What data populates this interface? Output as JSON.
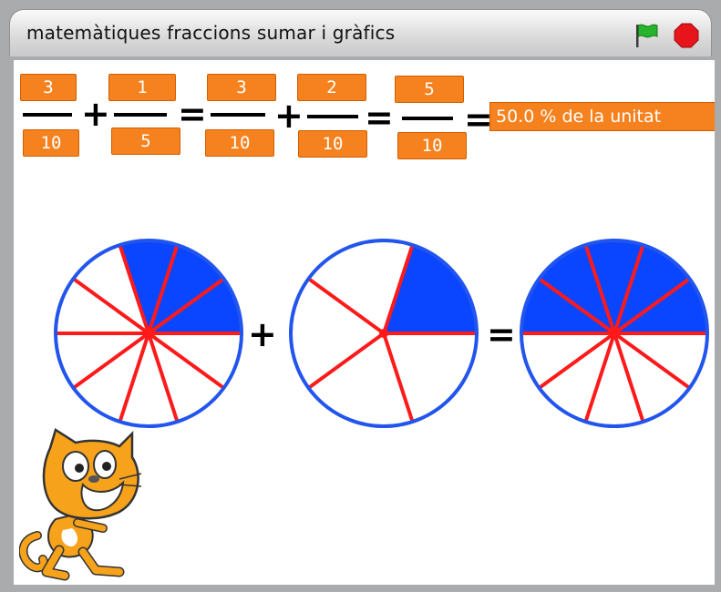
{
  "window": {
    "title": "matemàtiques fraccions sumar i gràfics",
    "flag_icon": "green-flag-icon",
    "stop_icon": "stop-sign-icon"
  },
  "colors": {
    "box_fill": "#f5821f",
    "pie_fill": "#0a46ff",
    "pie_outline": "#2255ee",
    "spokes": "#ff1a1a"
  },
  "equation": {
    "f1": {
      "num": "3",
      "den": "10"
    },
    "plus1": "+",
    "f2": {
      "num": "1",
      "den": "5"
    },
    "eq1": "=",
    "f3": {
      "num": "3",
      "den": "10"
    },
    "plus2": "+",
    "f4": {
      "num": "2",
      "den": "10"
    },
    "eq2": "=",
    "f5": {
      "num": "5",
      "den": "10"
    },
    "eq3": "=",
    "result": "50.0 % de la unitat"
  },
  "pies": [
    {
      "name": "pie-three-tenths",
      "slices": 10,
      "filled": 3
    },
    {
      "name": "pie-one-fifth",
      "slices": 5,
      "filled": 1
    },
    {
      "name": "pie-five-tenths",
      "slices": 10,
      "filled": 5
    }
  ],
  "pie_ops": {
    "plus": "+",
    "equals": "="
  },
  "sprite": "scratch-cat"
}
